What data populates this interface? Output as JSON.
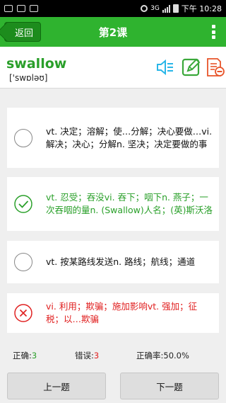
{
  "statusbar": {
    "clock": "下午 10:28",
    "network": "3G"
  },
  "appbar": {
    "back_label": "返回",
    "title": "第2课"
  },
  "word": {
    "text": "swallow",
    "phonetic": "['swɒləʊ]"
  },
  "options": [
    {
      "text": "vt. 决定；溶解；使…分解；决心要做…vi. 解决；决心；分解n. 坚决；决定要做的事",
      "state": "none"
    },
    {
      "text": "vt. 忍受；吞没vi. 吞下；咽下n. 燕子；一次吞咽的量n. (Swallow)人名；(英)斯沃洛",
      "state": "correct"
    },
    {
      "text": "vt. 按某路线发送n. 路线；航线；通道",
      "state": "none"
    },
    {
      "text": "vi. 利用；欺骗；施加影响vt. 强加；征税；以…欺骗",
      "state": "wrong"
    }
  ],
  "stats": {
    "correct_label": "正确:",
    "correct_count": "3",
    "wrong_label": "错误:",
    "wrong_count": "3",
    "rate_label": "正确率:",
    "rate_value": "50.0%"
  },
  "nav": {
    "prev_label": "上一题",
    "next_label": "下一题"
  },
  "colors": {
    "accent": "#2fb32f",
    "correct": "#2aa02a",
    "wrong": "#e02020"
  }
}
